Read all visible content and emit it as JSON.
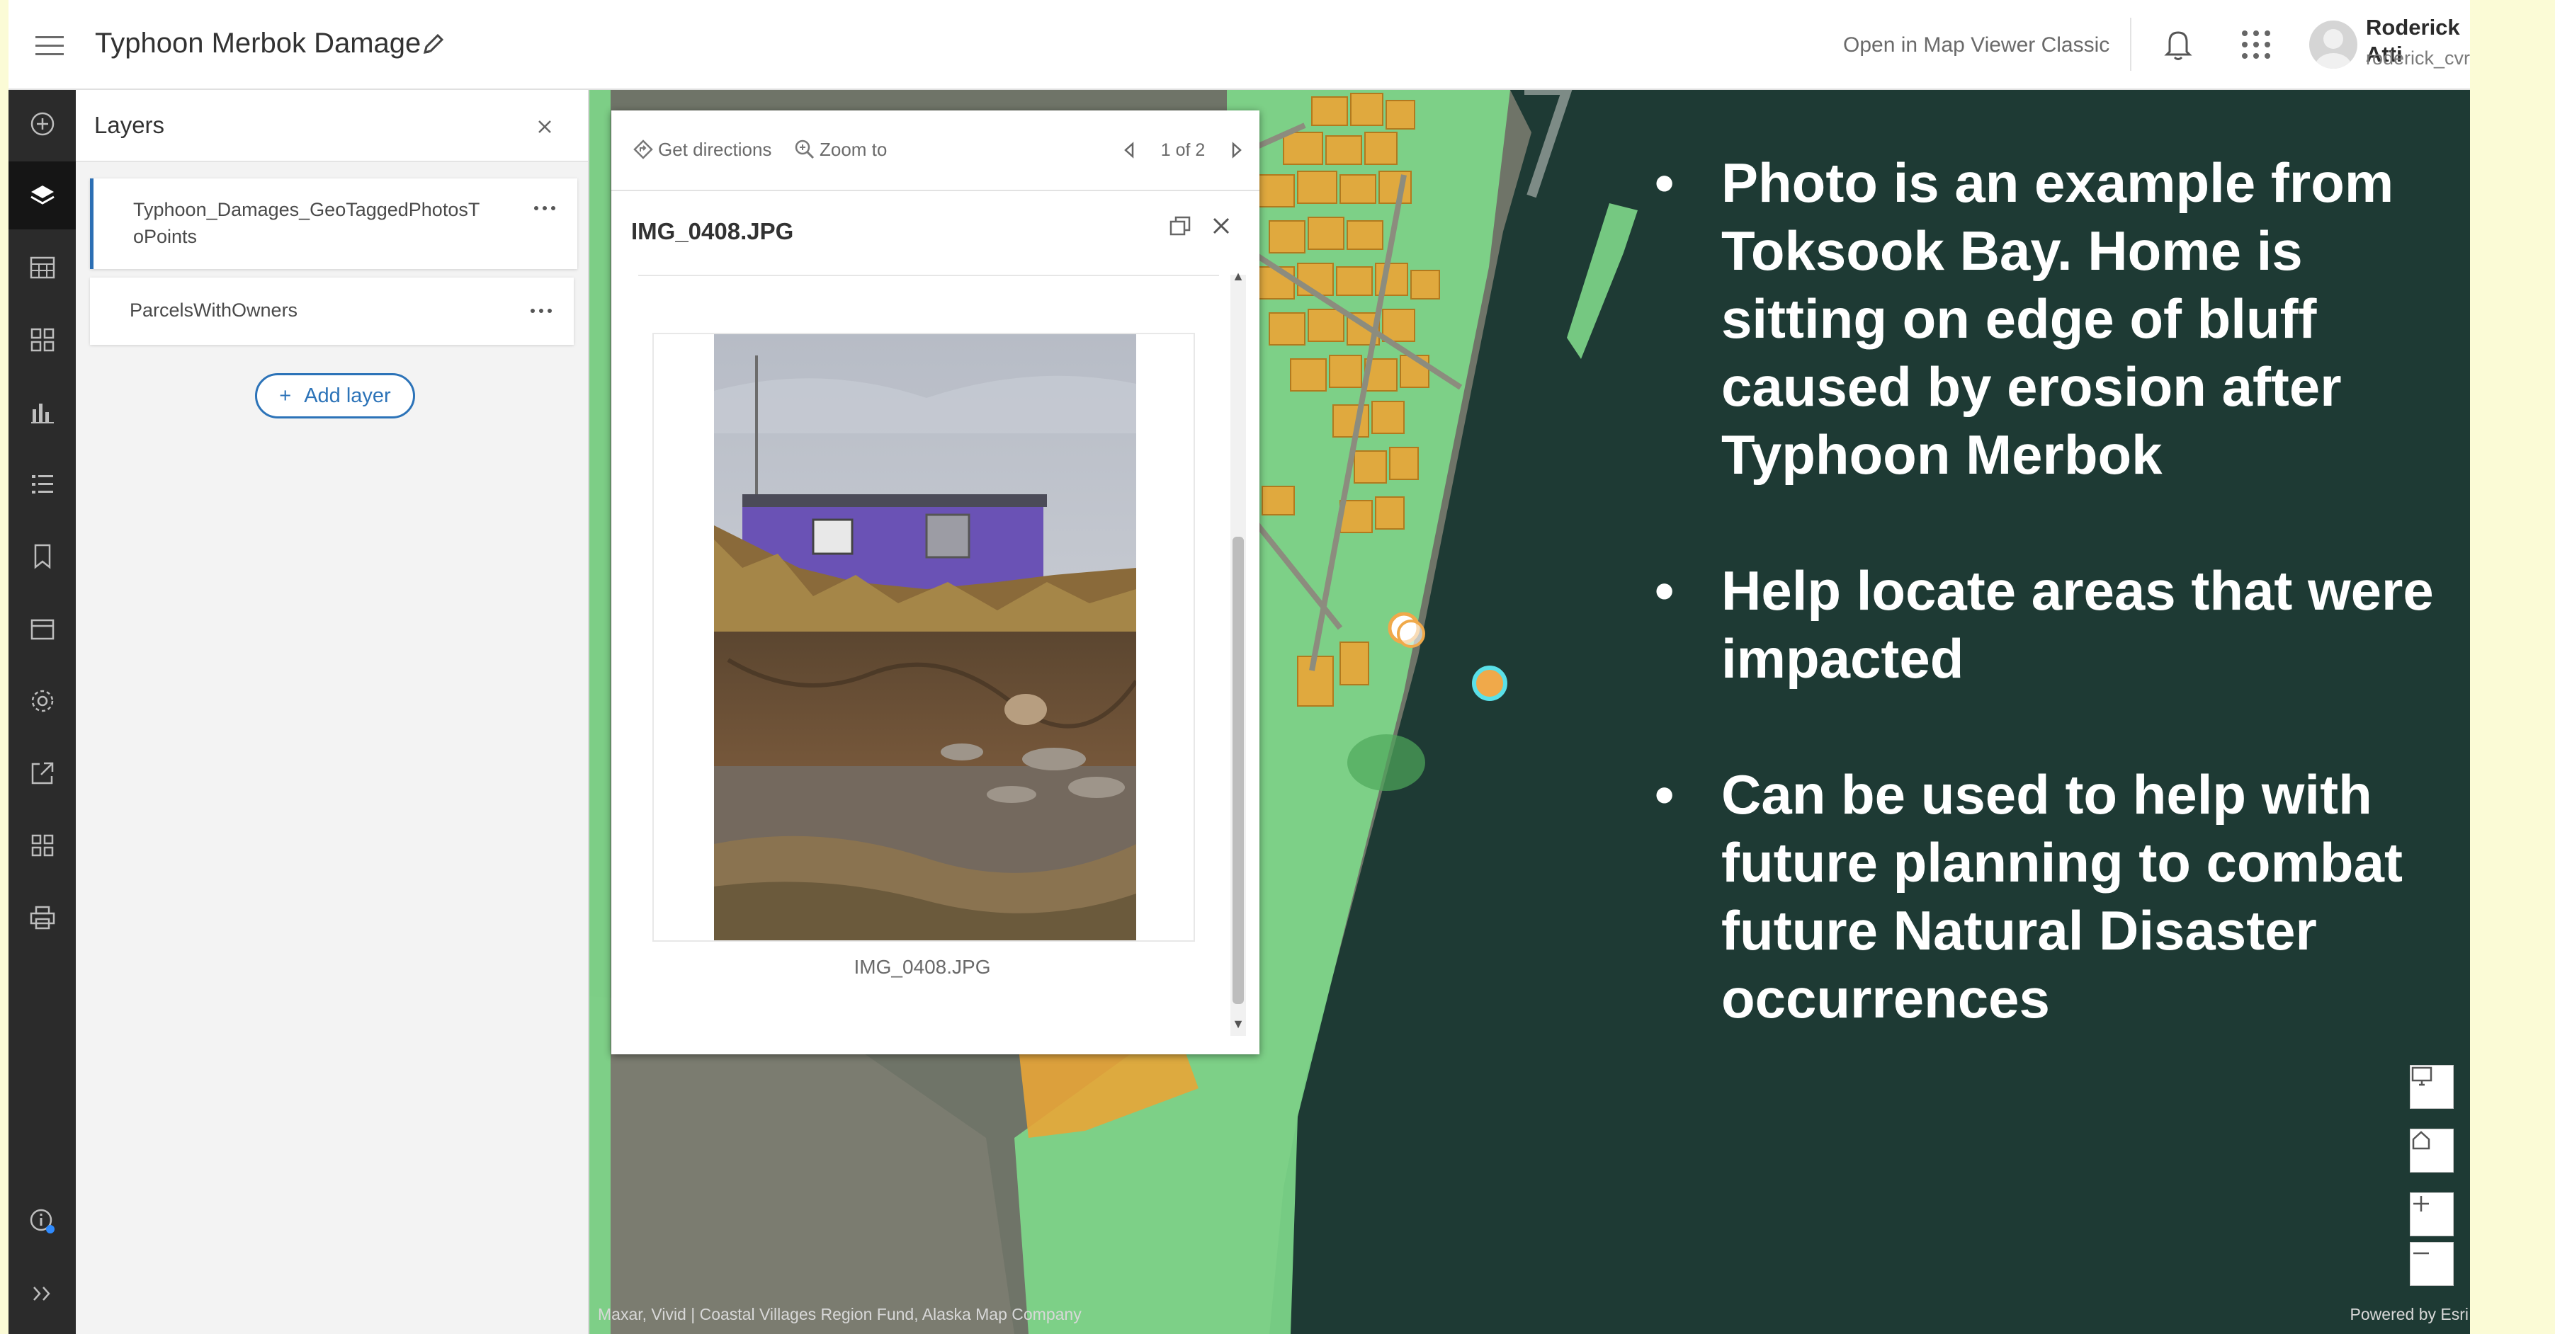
{
  "header": {
    "title": "Typhoon Merbok Damage",
    "open_classic": "Open in Map Viewer Classic",
    "user_name": "Roderick Atti",
    "user_handle": "roderick_cvrf"
  },
  "layers_panel": {
    "title": "Layers",
    "layers": [
      {
        "label": "Typhoon_Damages_GeoTaggedPhotosToPoints"
      },
      {
        "label": "ParcelsWithOwners"
      }
    ],
    "add_layer_label": "Add layer"
  },
  "popup": {
    "get_directions": "Get directions",
    "zoom_to": "Zoom to",
    "pager": "1 of 2",
    "title": "IMG_0408.JPG",
    "caption": "IMG_0408.JPG"
  },
  "map": {
    "attribution": "Maxar, Vivid | Coastal Villages Region Fund, Alaska Map Company",
    "powered_by": "Powered by Esri",
    "water_color": "#1e3a34",
    "parcel_orange": "#e8a537",
    "parcel_green": "#7ed88a"
  },
  "annotations": [
    "Photo is an example from Toksook Bay.  Home is sitting on edge of bluff caused by erosion after Typhoon Merbok",
    "Help locate areas that were impacted",
    "Can be used to help with future planning to combat future Natural Disaster occurrences"
  ],
  "icons": {
    "left_bar": [
      "add-icon",
      "layers-icon",
      "table-icon",
      "basemap-icon",
      "chart-icon",
      "legend-icon",
      "bookmark-icon",
      "calendar-icon",
      "settings-icon",
      "share-icon",
      "apps-grid-icon",
      "print-icon",
      "info-icon",
      "expand-icon"
    ],
    "right_bar": [
      "properties-icon",
      "styles-icon",
      "filter-icon",
      "effects-icon",
      "popups-icon",
      "fields-icon",
      "labels-icon",
      "edit-icon",
      "analysis-icon",
      "sketch-icon",
      "tools-icon",
      "collapse-icon"
    ]
  }
}
